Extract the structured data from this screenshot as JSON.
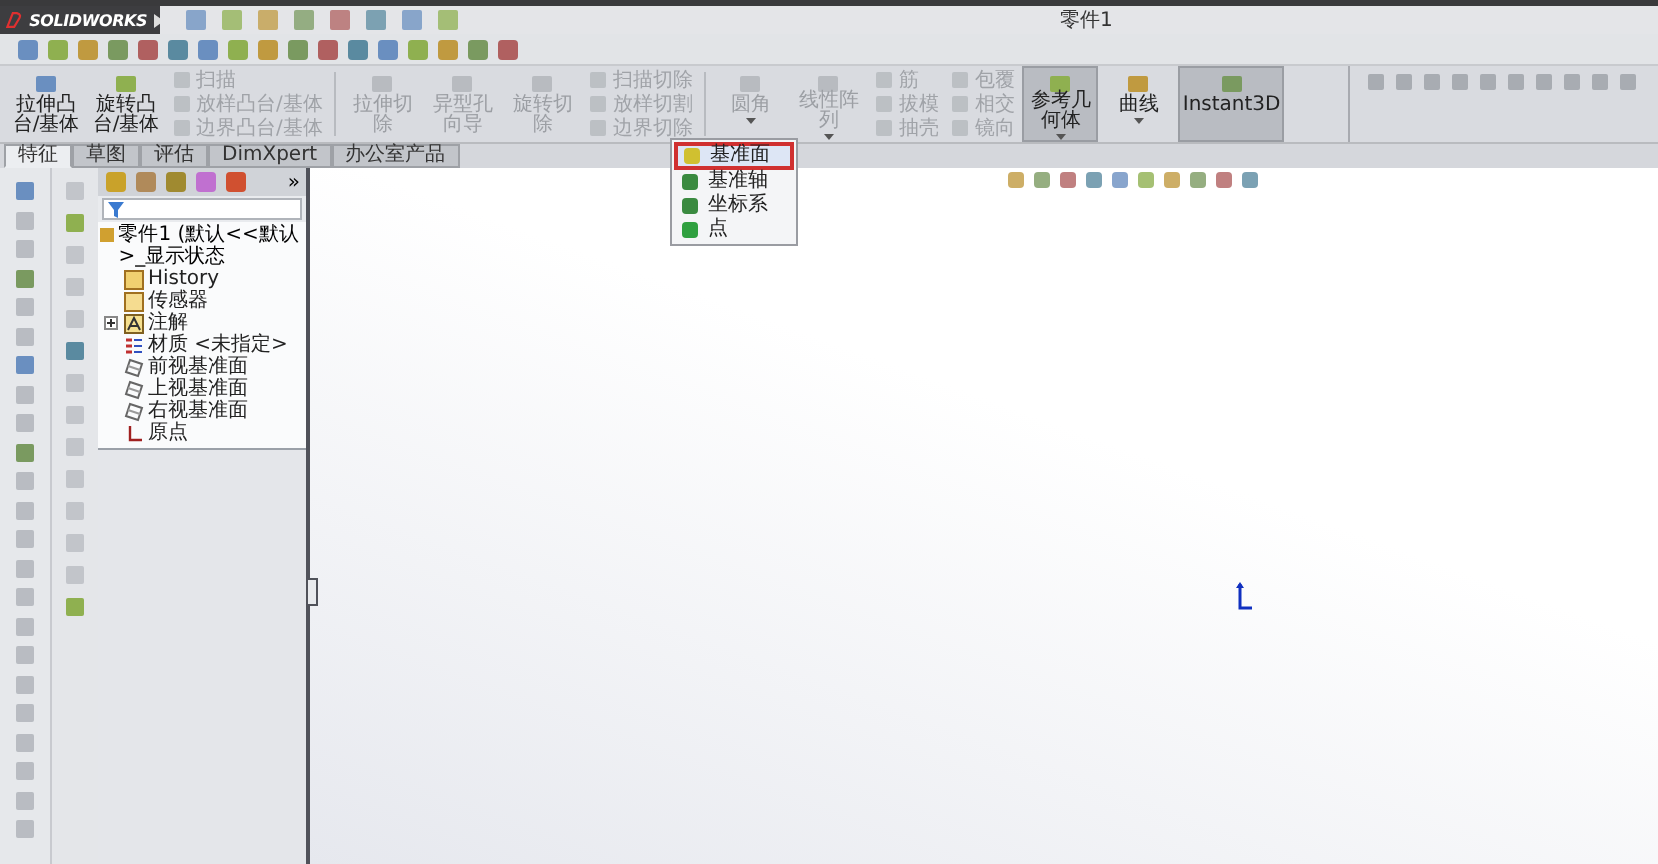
{
  "logo": "SOLIDWORKS",
  "title": "零件1",
  "ribbon": [
    {
      "kind": "big",
      "label": "拉伸凸台/基体",
      "disabled": false,
      "pressed": false,
      "dropdown": false
    },
    {
      "kind": "big",
      "label": "旋转凸台/基体",
      "disabled": false,
      "pressed": false,
      "dropdown": false
    },
    {
      "kind": "list",
      "items": [
        {
          "label": "扫描",
          "disabled": true
        },
        {
          "label": "放样凸台/基体",
          "disabled": true
        },
        {
          "label": "边界凸台/基体",
          "disabled": true
        }
      ]
    },
    {
      "kind": "sep"
    },
    {
      "kind": "big",
      "label": "拉伸切除",
      "disabled": true,
      "pressed": false,
      "dropdown": false
    },
    {
      "kind": "big",
      "label": "异型孔向导",
      "disabled": true,
      "pressed": false,
      "dropdown": false
    },
    {
      "kind": "big",
      "label": "旋转切除",
      "disabled": true,
      "pressed": false,
      "dropdown": false
    },
    {
      "kind": "list",
      "items": [
        {
          "label": "扫描切除",
          "disabled": true
        },
        {
          "label": "放样切割",
          "disabled": true
        },
        {
          "label": "边界切除",
          "disabled": true
        }
      ]
    },
    {
      "kind": "sep"
    },
    {
      "kind": "big",
      "label": "圆角",
      "disabled": true,
      "pressed": false,
      "dropdown": true
    },
    {
      "kind": "big",
      "label": "线性阵列",
      "disabled": true,
      "pressed": false,
      "dropdown": true
    },
    {
      "kind": "list",
      "items": [
        {
          "label": "筋",
          "disabled": true
        },
        {
          "label": "拔模",
          "disabled": true
        },
        {
          "label": "抽壳",
          "disabled": true
        }
      ]
    },
    {
      "kind": "list",
      "items": [
        {
          "label": "包覆",
          "disabled": true
        },
        {
          "label": "相交",
          "disabled": true
        },
        {
          "label": "镜向",
          "disabled": true
        }
      ]
    },
    {
      "kind": "big",
      "label": "参考几何体",
      "disabled": false,
      "pressed": true,
      "dropdown": true
    },
    {
      "kind": "big",
      "label": "曲线",
      "disabled": false,
      "pressed": false,
      "dropdown": true
    },
    {
      "kind": "big",
      "label": "Instant3D",
      "disabled": false,
      "pressed": true,
      "dropdown": false
    }
  ],
  "tabs": [
    {
      "label": "特征",
      "selected": true
    },
    {
      "label": "草图",
      "selected": false
    },
    {
      "label": "评估",
      "selected": false
    },
    {
      "label": "DimXpert",
      "selected": false
    },
    {
      "label": "办公室产品",
      "selected": false
    }
  ],
  "menu": [
    {
      "label": "基准面",
      "selected": true
    },
    {
      "label": "基准轴",
      "selected": false
    },
    {
      "label": "坐标系",
      "selected": false
    },
    {
      "label": "点",
      "selected": false
    }
  ],
  "panel_more": "»",
  "tree": {
    "label": "零件1 (默认<<默认>_显示状态",
    "children": [
      {
        "kind": "history",
        "label": "History"
      },
      {
        "kind": "sensor",
        "label": "传感器"
      },
      {
        "kind": "annotation",
        "label": "注解",
        "expanded": false
      },
      {
        "kind": "material",
        "label": "材质 <未指定>"
      },
      {
        "kind": "plane",
        "label": "前视基准面"
      },
      {
        "kind": "plane",
        "label": "上视基准面"
      },
      {
        "kind": "plane",
        "label": "右视基准面"
      },
      {
        "kind": "origin",
        "label": "原点"
      }
    ]
  }
}
